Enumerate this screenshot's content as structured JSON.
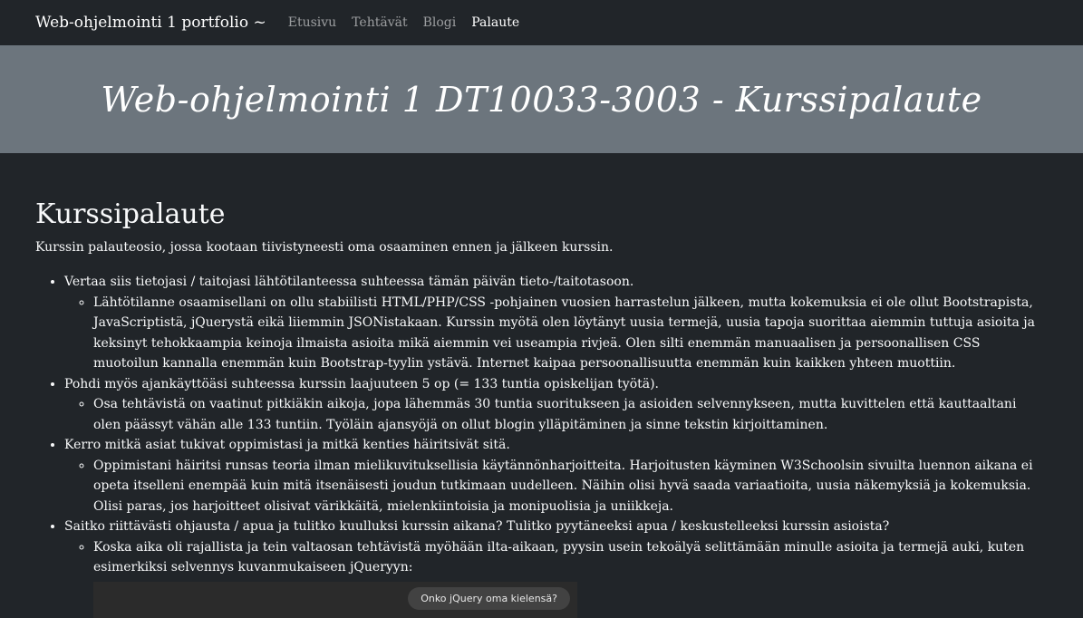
{
  "nav": {
    "brand": "Web-ohjelmointi 1 portfolio ~",
    "links": [
      "Etusivu",
      "Tehtävät",
      "Blogi",
      "Palaute"
    ]
  },
  "hero": {
    "title": "Web-ohjelmointi 1 DT10033-3003 - Kurssipalaute"
  },
  "main": {
    "title": "Kurssipalaute",
    "intro": "Kurssin palauteosio, jossa kootaan tiivistyneesti oma osaaminen ennen ja jälkeen kurssin.",
    "items": [
      {
        "question": "Vertaa siis tietojasi / taitojasi lähtötilanteessa suhteessa tämän päivän tieto-/taitotasoon.",
        "answer": "Lähtötilanne osaamisellani on ollu stabiilisti HTML/PHP/CSS -pohjainen vuosien harrastelun jälkeen, mutta kokemuksia ei ole ollut Bootstrapista, JavaScriptistä, jQuerystä eikä liiemmin JSONistakaan. Kurssin myötä olen löytänyt uusia termejä, uusia tapoja suorittaa aiemmin tuttuja asioita ja keksinyt tehokkaampia keinoja ilmaista asioita mikä aiemmin vei useampia rivjeä. Olen silti enemmän manuaalisen ja persoonallisen CSS muotoilun kannalla enemmän kuin Bootstrap-tyylin ystävä. Internet kaipaa persoonallisuutta enemmän kuin kaikken yhteen muottiin."
      },
      {
        "question": "Pohdi myös ajankäyttöäsi suhteessa kurssin laajuuteen 5 op (= 133 tuntia opiskelijan työtä).",
        "answer": "Osa tehtävistä on vaatinut pitkiäkin aikoja, jopa lähemmäs 30 tuntia suoritukseen ja asioiden selvennykseen, mutta kuvittelen että kauttaaltani olen päässyt vähän alle 133 tuntiin. Työläin ajansyöjä on ollut blogin ylläpitäminen ja sinne tekstin kirjoittaminen."
      },
      {
        "question": "Kerro mitkä asiat tukivat oppimistasi ja mitkä kenties häiritsivät sitä.",
        "answer": "Oppimistani häiritsi runsas teoria ilman mielikuvituksellisia käytännönharjoitteita. Harjoitusten käyminen W3Schoolsin sivuilta luennon aikana ei opeta itselleni enempää kuin mitä itsenäisesti joudun tutkimaan uudelleen. Näihin olisi hyvä saada variaatioita, uusia näkemyksiä ja kokemuksia. Olisi paras, jos harjoitteet olisivat värikkäitä, mielenkiintoisia ja monipuolisia ja uniikkeja."
      },
      {
        "question": "Saitko riittävästi ohjausta / apua ja tulitko kuulluksi kurssin aikana? Tulitko pyytäneeksi apua / keskustelleeksi kurssin asioista?",
        "answer": "Koska aika oli rajallista ja tein valtaosan tehtävistä myöhään ilta-aikaan, pyysin usein tekoälyä selittämään minulle asioita ja termejä auki, kuten esimerkiksi selvennys kuvanmukaiseen jQueryyn:"
      }
    ],
    "chat_bubble": "Onko jQuery oma kielensä?"
  }
}
